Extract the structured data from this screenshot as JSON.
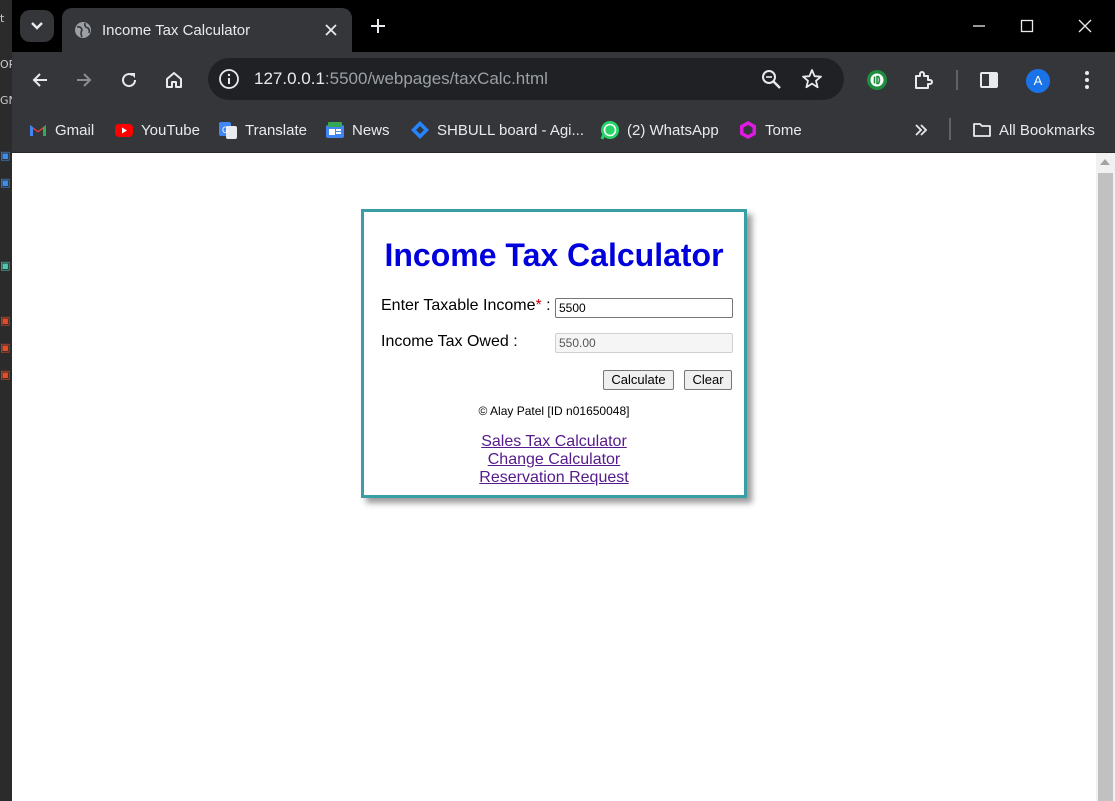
{
  "browser": {
    "tab_title": "Income Tax Calculator",
    "url_host": "127.0.0.1",
    "url_rest": ":5500/webpages/taxCalc.html",
    "profile_initial": "A",
    "bookmarks": [
      {
        "label": "Gmail",
        "icon": "gmail-icon"
      },
      {
        "label": "YouTube",
        "icon": "youtube-icon"
      },
      {
        "label": "Translate",
        "icon": "translate-icon"
      },
      {
        "label": "News",
        "icon": "news-icon"
      },
      {
        "label": "SHBULL board - Agi...",
        "icon": "jira-icon"
      },
      {
        "label": "(2) WhatsApp",
        "icon": "whatsapp-icon"
      },
      {
        "label": "Tome",
        "icon": "tome-icon"
      }
    ],
    "all_bookmarks": "All Bookmarks"
  },
  "calculator": {
    "title": "Income Tax Calculator",
    "income_label": "Enter Taxable Income",
    "required_mark": "*",
    "income_colon": " :",
    "income_value": "5500",
    "owed_label": "Income Tax Owed :",
    "owed_value": "550.00",
    "calculate_label": "Calculate",
    "clear_label": "Clear",
    "copyright": "© Alay Patel [ID n01650048]",
    "links": [
      "Sales Tax Calculator",
      "Change Calculator",
      "Reservation Request"
    ]
  },
  "colors": {
    "heading": "#0000dd",
    "card_border": "#3a9ea5",
    "link": "#551a8b"
  }
}
